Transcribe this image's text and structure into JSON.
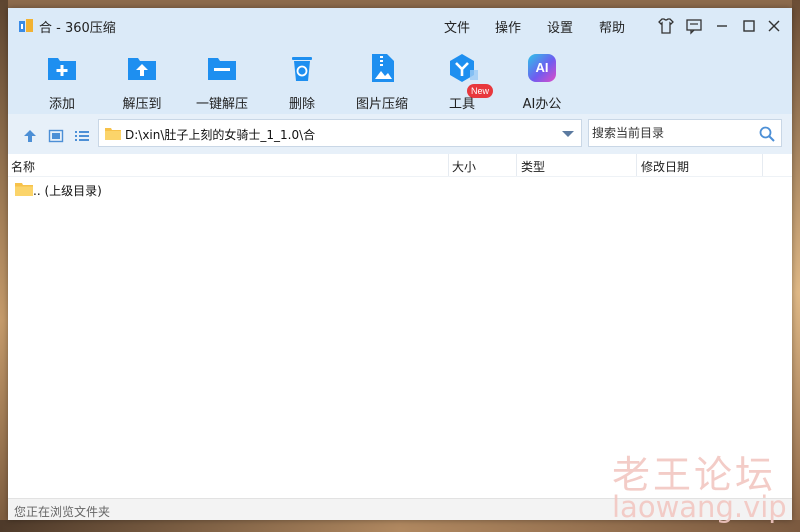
{
  "window": {
    "title": "合 - 360压缩"
  },
  "menu": {
    "file": "文件",
    "operate": "操作",
    "settings": "设置",
    "help": "帮助"
  },
  "toolbar": {
    "items": [
      {
        "label": "添加",
        "icon": "add-folder-icon"
      },
      {
        "label": "解压到",
        "icon": "extract-to-icon"
      },
      {
        "label": "一键解压",
        "icon": "one-click-extract-icon"
      },
      {
        "label": "删除",
        "icon": "trash-icon"
      },
      {
        "label": "图片压缩",
        "icon": "image-compress-icon"
      },
      {
        "label": "工具",
        "icon": "tools-icon",
        "badge": "New"
      },
      {
        "label": "AI办公",
        "icon": "ai-icon",
        "icon_text": "AI"
      }
    ]
  },
  "address": {
    "path": "D:\\xin\\肚子上刻的女骑士_1_1.0\\合"
  },
  "search": {
    "placeholder": "搜索当前目录"
  },
  "columns": {
    "name": "名称",
    "size": "大小",
    "type": "类型",
    "modified": "修改日期"
  },
  "files": [
    {
      "name": ".. (上级目录)"
    }
  ],
  "status": {
    "text": "您正在浏览文件夹"
  },
  "watermark": {
    "line1": "老王论坛",
    "line2": "laowang.vip"
  },
  "colors": {
    "accent": "#1e8ff0",
    "toolbar_bg": "#dbeaf8",
    "badge": "#e8383d",
    "folder": "#f7c24a"
  }
}
